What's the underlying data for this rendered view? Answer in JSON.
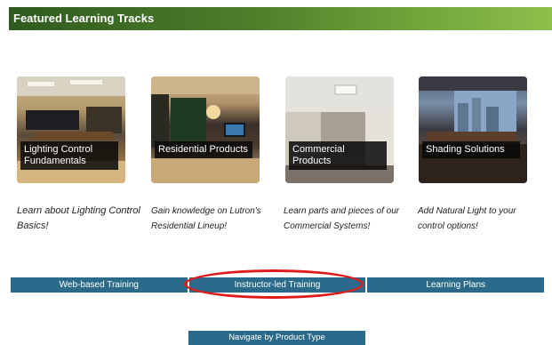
{
  "banner": {
    "title": "Featured Learning Tracks"
  },
  "tracks": [
    {
      "caption": "Lighting Control Fundamentals",
      "description": "Learn about Lighting Control Basics!"
    },
    {
      "caption": "Residential Products",
      "description": "Gain knowledge on Lutron's Residential Lineup!"
    },
    {
      "caption": "Commercial Products",
      "description": "Learn parts and pieces of our Commercial Systems!"
    },
    {
      "caption": "Shading Solutions",
      "description": "Add Natural Light to your control options!"
    }
  ],
  "nav": {
    "items": [
      {
        "label": "Web-based Training"
      },
      {
        "label": "Instructor-led Training",
        "highlighted": true
      },
      {
        "label": "Learning Plans"
      }
    ]
  },
  "product_nav": {
    "label": "Navigate by Product Type"
  },
  "colors": {
    "banner_green": "#4d7f2b",
    "nav_blue": "#2b6a8a",
    "highlight_red": "#e01a1a"
  }
}
